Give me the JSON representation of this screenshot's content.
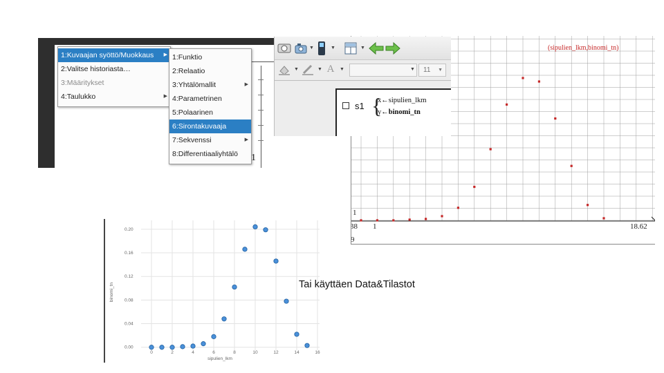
{
  "menu_screenshot": {
    "main_menu": [
      {
        "label": "1:Kuvaajan syöttö/Muokkaus",
        "selected": true,
        "submenu": true
      },
      {
        "label": "2:Valitse historiasta…",
        "selected": false,
        "submenu": false
      },
      {
        "label": "3:Määritykset",
        "disabled": true,
        "submenu": false
      },
      {
        "label": "4:Taulukko",
        "selected": false,
        "submenu": true
      }
    ],
    "sub_menu": [
      {
        "label": "1:Funktio",
        "submenu": false
      },
      {
        "label": "2:Relaatio",
        "submenu": false
      },
      {
        "label": "3:Yhtälömallit",
        "submenu": true
      },
      {
        "label": "4:Parametrinen",
        "submenu": false
      },
      {
        "label": "5:Polaarinen",
        "submenu": false
      },
      {
        "label": "6:Sirontakuvaaja",
        "submenu": false,
        "selected": true
      },
      {
        "label": "7:Sekvenssi",
        "submenu": true
      },
      {
        "label": "8:Differentiaaliyhtälö",
        "submenu": false
      }
    ],
    "background_number": "1"
  },
  "toolbar_screenshot": {
    "font_size_value": "11",
    "s1": {
      "label": "s1",
      "x_line": "x←sipulien_lkm",
      "y_line_prefix": "y←",
      "y_line_value": "binomi_tn"
    }
  },
  "graph_screenshot": {
    "plot_label": "(sipulien_lkm,binomi_tn)",
    "y_tick_label": "1",
    "x_tick_label": "1",
    "x_min_label": "38",
    "x_max_label": "18.62",
    "bottom_left_label": "9",
    "colors": {
      "points": "#c62828",
      "grid": "#9e9e9e"
    }
  },
  "chart_data": [
    {
      "type": "scatter",
      "title": "",
      "xlabel": "sipulien_lkm",
      "ylabel": "binomi_tn",
      "x": [
        0,
        1,
        2,
        3,
        4,
        5,
        6,
        7,
        8,
        9,
        10,
        11,
        12,
        13,
        14,
        15
      ],
      "y": [
        0.0,
        0.0,
        0.0,
        0.001,
        0.002,
        0.006,
        0.018,
        0.048,
        0.102,
        0.166,
        0.204,
        0.199,
        0.146,
        0.078,
        0.022,
        0.003
      ],
      "xticks": [
        "0",
        "2",
        "4",
        "6",
        "8",
        "10",
        "12",
        "14",
        "16"
      ],
      "yticks": [
        "0.00",
        "0.04",
        "0.08",
        "0.12",
        "0.16",
        "0.20"
      ],
      "xtick_values": [
        0,
        2,
        4,
        6,
        8,
        10,
        12,
        14,
        16
      ],
      "ytick_values": [
        0,
        0.04,
        0.08,
        0.12,
        0.16,
        0.2
      ],
      "xlim": [
        -1,
        16.2
      ],
      "ylim": [
        -0.012,
        0.215
      ],
      "grid": true,
      "colors": {
        "points": "#4a90d9",
        "point_edge": "#1f5f9f"
      }
    }
  ],
  "caption": "Tai käyttäen Data&Tilastot"
}
